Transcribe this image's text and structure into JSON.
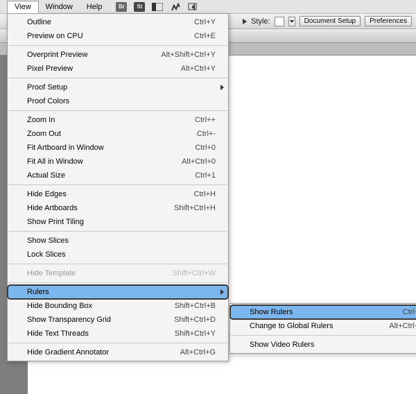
{
  "menubar": {
    "view": "View",
    "window": "Window",
    "help": "Help"
  },
  "secondbar": {
    "style_label": "Style:",
    "doc_setup": "Document Setup",
    "preferences": "Preferences"
  },
  "view_menu": {
    "outline": {
      "label": "Outline",
      "sc": "Ctrl+Y"
    },
    "preview_gpu": {
      "label": "Preview on CPU",
      "sc": "Ctrl+E"
    },
    "overprint": {
      "label": "Overprint Preview",
      "sc": "Alt+Shift+Ctrl+Y"
    },
    "pixel": {
      "label": "Pixel Preview",
      "sc": "Alt+Ctrl+Y"
    },
    "proof_setup": {
      "label": "Proof Setup"
    },
    "proof_colors": {
      "label": "Proof Colors"
    },
    "zoom_in": {
      "label": "Zoom In",
      "sc": "Ctrl++"
    },
    "zoom_out": {
      "label": "Zoom Out",
      "sc": "Ctrl+-"
    },
    "fit_artboard": {
      "label": "Fit Artboard in Window",
      "sc": "Ctrl+0"
    },
    "fit_all": {
      "label": "Fit All in Window",
      "sc": "Alt+Ctrl+0"
    },
    "actual_size": {
      "label": "Actual Size",
      "sc": "Ctrl+1"
    },
    "hide_edges": {
      "label": "Hide Edges",
      "sc": "Ctrl+H"
    },
    "hide_artboards": {
      "label": "Hide Artboards",
      "sc": "Shift+Ctrl+H"
    },
    "show_print_tiling": {
      "label": "Show Print Tiling"
    },
    "show_slices": {
      "label": "Show Slices"
    },
    "lock_slices": {
      "label": "Lock Slices"
    },
    "hide_template": {
      "label": "Hide Template",
      "sc": "Shift+Ctrl+W"
    },
    "rulers": {
      "label": "Rulers"
    },
    "hide_bounding": {
      "label": "Hide Bounding Box",
      "sc": "Shift+Ctrl+B"
    },
    "show_transparency": {
      "label": "Show Transparency Grid",
      "sc": "Shift+Ctrl+D"
    },
    "hide_text_threads": {
      "label": "Hide Text Threads",
      "sc": "Shift+Ctrl+Y"
    },
    "hide_gradient": {
      "label": "Hide Gradient Annotator",
      "sc": "Alt+Ctrl+G"
    }
  },
  "rulers_submenu": {
    "show_rulers": {
      "label": "Show Rulers",
      "sc": "Ctrl+R"
    },
    "change_global": {
      "label": "Change to Global Rulers",
      "sc": "Alt+Ctrl+R"
    },
    "show_video": {
      "label": "Show Video Rulers"
    }
  }
}
